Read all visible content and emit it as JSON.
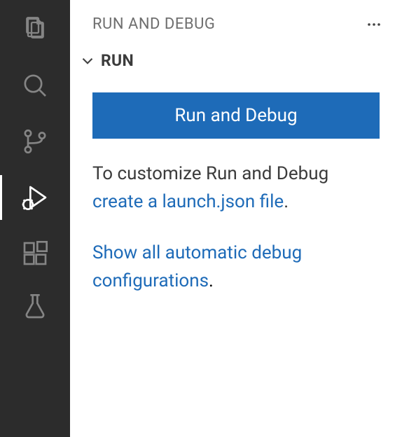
{
  "sidebar": {
    "title": "RUN AND DEBUG",
    "section": {
      "title": "RUN",
      "run_button_label": "Run and Debug",
      "help": {
        "prefix": "To customize Run and Debug ",
        "link": "create a launch.json file",
        "suffix": "."
      },
      "help2": {
        "link": "Show all automatic debug configurations",
        "suffix": "."
      }
    }
  },
  "activity_bar": {
    "items": [
      {
        "name": "explorer",
        "active": false
      },
      {
        "name": "search",
        "active": false
      },
      {
        "name": "source-control",
        "active": false
      },
      {
        "name": "run-debug",
        "active": true
      },
      {
        "name": "extensions",
        "active": false
      },
      {
        "name": "testing",
        "active": false
      }
    ]
  }
}
